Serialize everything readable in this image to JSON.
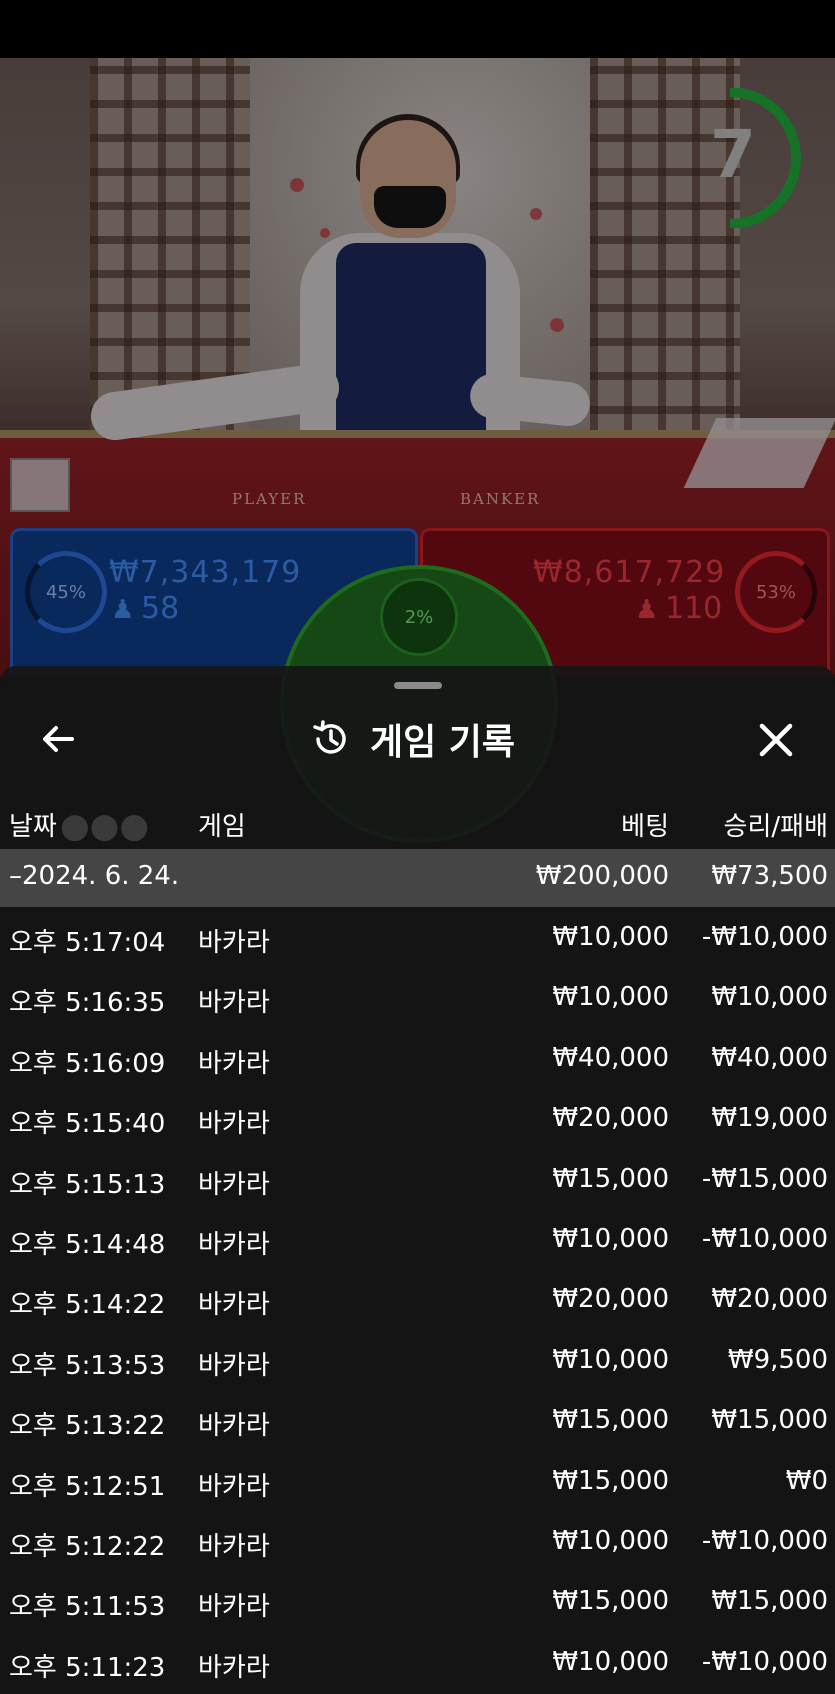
{
  "timer": {
    "value": "7",
    "color": "#1fa83a"
  },
  "table": {
    "player_label": "PLAYER",
    "banker_label": "BANKER"
  },
  "player": {
    "percent": "45%",
    "amount": "₩7,343,179",
    "count": "58",
    "color": "#2d6ad8"
  },
  "banker": {
    "percent": "53%",
    "amount": "₩8,617,729",
    "count": "110",
    "color": "#d6252f"
  },
  "tie": {
    "percent": "2%"
  },
  "history": {
    "title": "게임 기록",
    "back_icon": "arrow-left-icon",
    "history_icon": "history-clock-icon",
    "close_icon": "close-icon",
    "columns": {
      "date": "날짜",
      "game": "게임",
      "bet": "베팅",
      "result": "승리/패배"
    },
    "summary": {
      "date": "–2024. 6. 24.",
      "bet": "₩200,000",
      "result": "₩73,500"
    },
    "rows": [
      {
        "time": "오후 5:17:04",
        "game": "바카라",
        "bet": "₩10,000",
        "result": "-₩10,000"
      },
      {
        "time": "오후 5:16:35",
        "game": "바카라",
        "bet": "₩10,000",
        "result": "₩10,000"
      },
      {
        "time": "오후 5:16:09",
        "game": "바카라",
        "bet": "₩40,000",
        "result": "₩40,000"
      },
      {
        "time": "오후 5:15:40",
        "game": "바카라",
        "bet": "₩20,000",
        "result": "₩19,000"
      },
      {
        "time": "오후 5:15:13",
        "game": "바카라",
        "bet": "₩15,000",
        "result": "-₩15,000"
      },
      {
        "time": "오후 5:14:48",
        "game": "바카라",
        "bet": "₩10,000",
        "result": "-₩10,000"
      },
      {
        "time": "오후 5:14:22",
        "game": "바카라",
        "bet": "₩20,000",
        "result": "₩20,000"
      },
      {
        "time": "오후 5:13:53",
        "game": "바카라",
        "bet": "₩10,000",
        "result": "₩9,500"
      },
      {
        "time": "오후 5:13:22",
        "game": "바카라",
        "bet": "₩15,000",
        "result": "₩15,000"
      },
      {
        "time": "오후 5:12:51",
        "game": "바카라",
        "bet": "₩15,000",
        "result": "₩0"
      },
      {
        "time": "오후 5:12:22",
        "game": "바카라",
        "bet": "₩10,000",
        "result": "-₩10,000"
      },
      {
        "time": "오후 5:11:53",
        "game": "바카라",
        "bet": "₩15,000",
        "result": "₩15,000"
      },
      {
        "time": "오후 5:11:23",
        "game": "바카라",
        "bet": "₩10,000",
        "result": "-₩10,000"
      }
    ]
  }
}
